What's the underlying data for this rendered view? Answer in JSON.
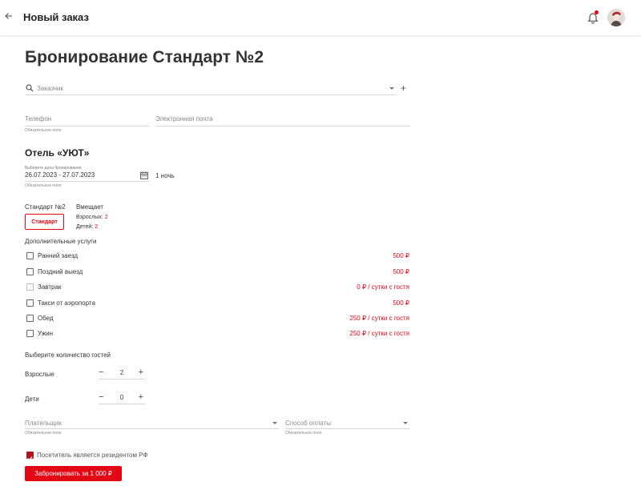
{
  "header": {
    "title": "Новый заказ",
    "back_icon": "arrow-left-icon",
    "bell_icon": "bell-icon"
  },
  "page_title": "Бронирование Стандарт №2",
  "customer": {
    "placeholder": "Заказчик"
  },
  "phone": {
    "placeholder": "Телефон",
    "hint": "Обязательное поле"
  },
  "email": {
    "placeholder": "Электронная почта"
  },
  "hotel": {
    "title": "Отель «УЮТ»"
  },
  "dates": {
    "label": "Выберите даты бронирования",
    "value": "26.07.2023 - 27.07.2023",
    "hint": "Обязательное поле",
    "nights": "1 ночь"
  },
  "room": {
    "name": "Стандарт №2",
    "button_label": "Стандарт",
    "fits_label": "Вмещает",
    "adults_label": "Взрослых:",
    "adults": "2",
    "children_label": "Детей:",
    "children": "2"
  },
  "services": {
    "title": "Дополнительные услуги",
    "items": [
      {
        "label": "Ранний заезд",
        "price": "500 ₽",
        "checked": false,
        "disabled": false
      },
      {
        "label": "Поздний выезд",
        "price": "500 ₽",
        "checked": false,
        "disabled": false
      },
      {
        "label": "Завтрак",
        "price": "0 ₽ / сутки с гостя",
        "checked": false,
        "disabled": true
      },
      {
        "label": "Такси от аэропорта",
        "price": "500 ₽",
        "checked": false,
        "disabled": false
      },
      {
        "label": "Обед",
        "price": "250 ₽ / сутки с гостя",
        "checked": false,
        "disabled": false
      },
      {
        "label": "Ужин",
        "price": "250 ₽ / сутки с гостя",
        "checked": false,
        "disabled": false
      }
    ]
  },
  "guests": {
    "title": "Выберите количество гостей",
    "adults_label": "Взрослые",
    "adults_value": "2",
    "children_label": "Дети",
    "children_value": "0"
  },
  "payer": {
    "placeholder": "Плательщик",
    "hint": "Обязательное поле"
  },
  "payment": {
    "placeholder": "Способ оплаты",
    "hint": "Обязательное поле"
  },
  "resident": {
    "label": "Посетитель является резидентом РФ",
    "checked": true
  },
  "book_button": "Забронировать за 1 000 ₽",
  "colors": {
    "accent": "#e30613",
    "checkbox_checked": "#b3121f"
  }
}
